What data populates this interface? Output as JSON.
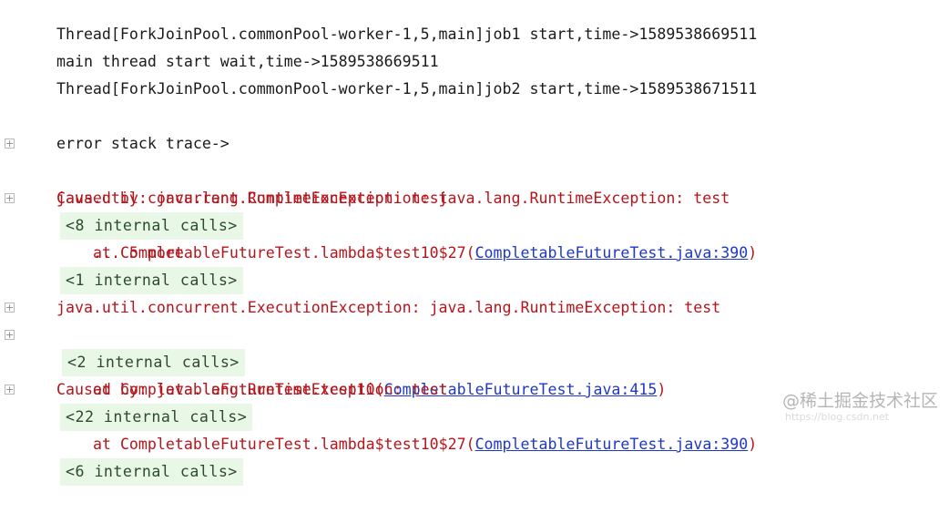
{
  "console": {
    "lines": {
      "l1": "Thread[ForkJoinPool.commonPool-worker-1,5,main]job1 start,time->1589538669511",
      "l2": "main thread start wait,time->1589538669511",
      "l3": "Thread[ForkJoinPool.commonPool-worker-1,5,main]job2 start,time->1589538671511",
      "l5": "error stack trace->",
      "l6_text": "java.util.concurrent.CompletionException: java.lang.RuntimeException: test",
      "l6_internal": "<8 internal calls>",
      "l7": "Caused by: java.lang.RuntimeException: test",
      "l8_pre": "at CompletableFutureTest.lambda$test10$27(",
      "l8_link": "CompletableFutureTest.java:390",
      "l8_post": ")",
      "l8_internal": "<1 internal calls>",
      "l9": "... 5 more",
      "l11": "java.util.concurrent.ExecutionException: java.lang.RuntimeException: test",
      "l12_internal": "<2 internal calls>",
      "l13_pre": "at CompletableFutureTest.test10(",
      "l13_link": "CompletableFutureTest.java:415",
      "l13_post": ")",
      "l13_internal": "<22 internal calls>",
      "l14": "Caused by: java.lang.RuntimeException: test",
      "l15_pre": "at CompletableFutureTest.lambda$test10$27(",
      "l15_link": "CompletableFutureTest.java:390",
      "l15_post": ")",
      "l15_internal": "<6 internal calls>"
    },
    "fold_icon": "plus-box-icon"
  },
  "watermark": {
    "main": "@稀土掘金技术社区",
    "small": "https://blog.csdn.net"
  },
  "colors": {
    "error_red": "#b8141b",
    "link_blue": "#1f38c9",
    "internal_bg": "#e9f7e6",
    "text": "#1a1a1a"
  }
}
